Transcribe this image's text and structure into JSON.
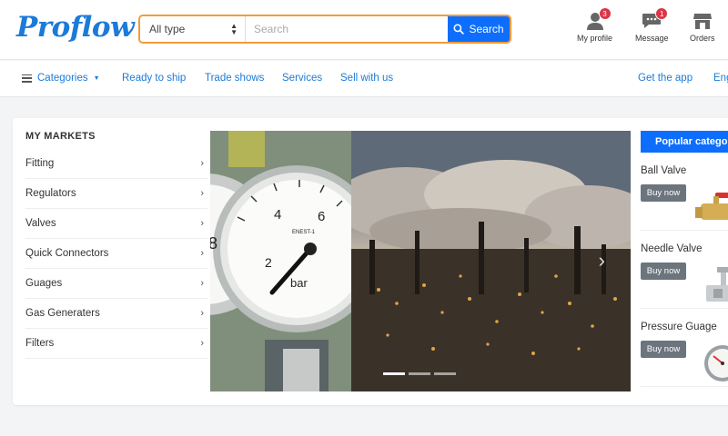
{
  "header": {
    "logo": "Proflow",
    "search": {
      "type_selected": "All type",
      "placeholder": "Search",
      "button_label": "Search"
    },
    "icons": [
      {
        "label": "My profile",
        "badge": "3",
        "icon": "user-icon"
      },
      {
        "label": "Message",
        "badge": "1",
        "icon": "message-icon"
      },
      {
        "label": "Orders",
        "icon": "store-icon"
      }
    ]
  },
  "nav": {
    "categories_label": "Categories",
    "links": [
      "Ready to ship",
      "Trade shows",
      "Services",
      "Sell with us"
    ],
    "get_app": "Get the app",
    "language": "English"
  },
  "markets": {
    "title": "MY MARKETS",
    "items": [
      "Fitting",
      "Regulators",
      "Valves",
      "Quick Connectors",
      "Guages",
      "Gas Generaters",
      "Filters"
    ]
  },
  "banner": {
    "gauge_labels": [
      "4",
      "6",
      "bar",
      "ENEST-1",
      "8",
      "2"
    ],
    "slides": 3,
    "active_slide": 1
  },
  "popular": {
    "title": "Popular category",
    "items": [
      {
        "name": "Ball Valve",
        "button": "Buy now"
      },
      {
        "name": "Needle Valve",
        "button": "Buy now"
      },
      {
        "name": "Pressure Guage",
        "button": "Buy now"
      }
    ]
  },
  "colors": {
    "brand": "#1b7bd8",
    "primary": "#0d6efd",
    "search_border": "#f39a3c",
    "badge": "#dc3545",
    "buy_button": "#6c757d"
  }
}
